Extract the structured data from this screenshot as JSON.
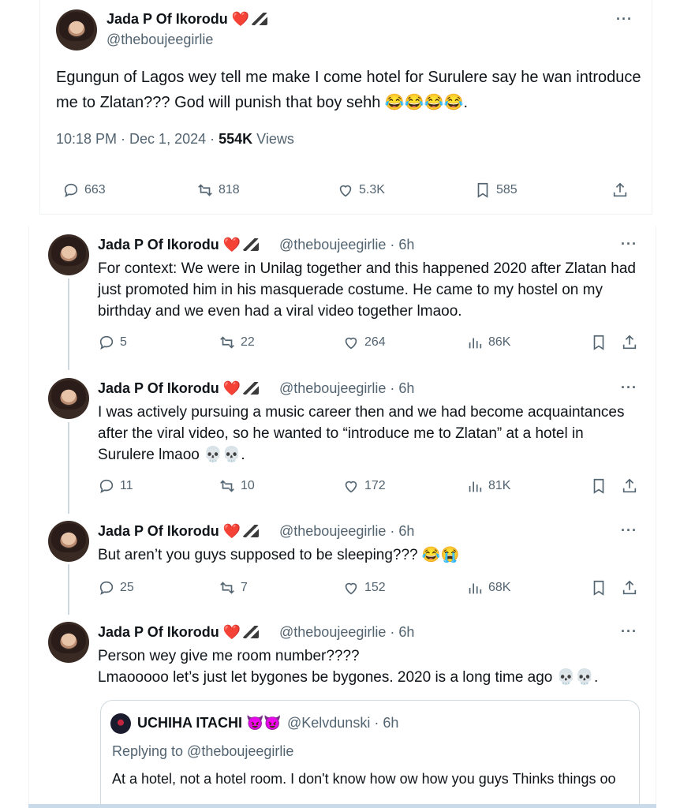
{
  "main_tweet": {
    "name": "Jada P Of Ikorodu ❤️",
    "handle": "@theboujeegirlie",
    "text": "Egungun of Lagos wey tell me make I come hotel for Surulere say he wan introduce me to Zlatan??? God will punish that boy sehh 😂😂😂😂.",
    "time": "10:18 PM · Dec 1, 2024 ·",
    "views_count": "554K",
    "views_label": "Views",
    "replies": "663",
    "reposts": "818",
    "likes": "5.3K",
    "bookmarks": "585"
  },
  "thread": [
    {
      "name": "Jada P Of Ikorodu ❤️",
      "handle": "@theboujeegirlie · 6h",
      "text": "For context: We were in Unilag together and this happened 2020 after Zlatan had just promoted him in his masquerade costume. He came to my hostel on my birthday and we even had a viral video together lmaoo.",
      "replies": "5",
      "reposts": "22",
      "likes": "264",
      "views": "86K"
    },
    {
      "name": "Jada P Of Ikorodu ❤️",
      "handle": "@theboujeegirlie · 6h",
      "text": "I was actively pursuing a music career then and we had become acquaintances after the viral video, so he wanted to “introduce me to Zlatan” at a hotel in Surulere lmaoo 💀💀.",
      "replies": "11",
      "reposts": "10",
      "likes": "172",
      "views": "81K"
    },
    {
      "name": "Jada P Of Ikorodu ❤️",
      "handle": "@theboujeegirlie · 6h",
      "text": "But aren’t you guys supposed to be sleeping??? 😂😭",
      "replies": "25",
      "reposts": "7",
      "likes": "152",
      "views": "68K"
    },
    {
      "name": "Jada P Of Ikorodu ❤️",
      "handle": "@theboujeegirlie · 6h",
      "text_line1": "Person wey give me room number????",
      "text_line2": "Lmaooooo let’s just let bygones be bygones. 2020 is a long time ago 💀💀."
    }
  ],
  "quote": {
    "name": "UCHIHA ITACHI 😈😈",
    "handle": "@Kelvdunski · 6h",
    "replying": "Replying to @theboujeegirlie",
    "text": "At a hotel, not a hotel room. I don't know how ow how you guys Thinks things oo"
  },
  "more_icon": "···",
  "colors": {
    "accent": "#1d9bf0",
    "muted": "#536471",
    "heart": "#e0245e"
  }
}
